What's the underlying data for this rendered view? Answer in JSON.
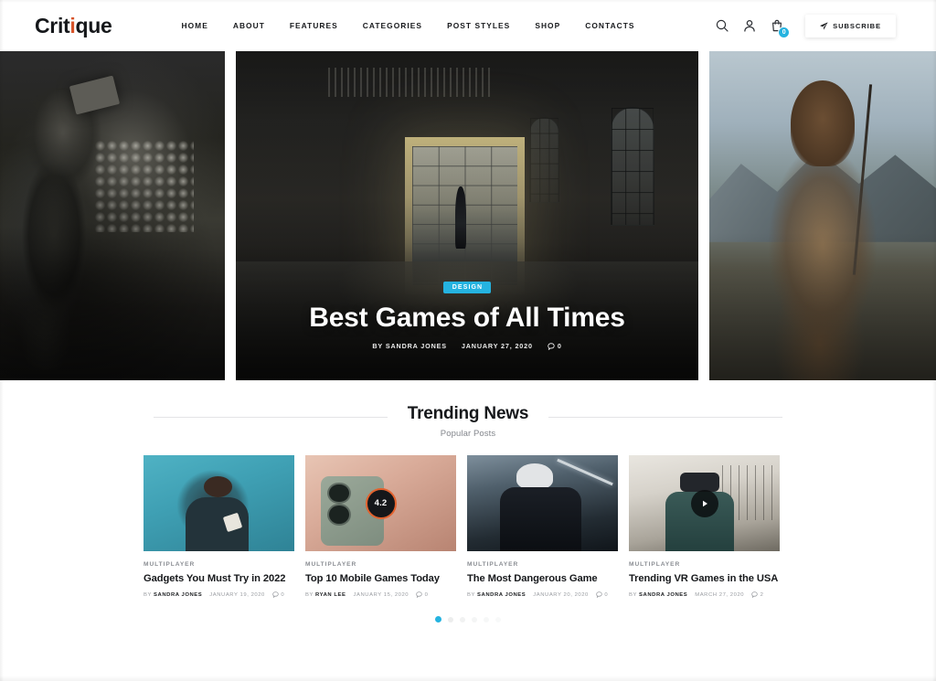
{
  "site": {
    "logo_text": "Critique",
    "logo_accent_letter": "i",
    "accent_color": "#d8542a",
    "brand_blue": "#25b3e0"
  },
  "nav": {
    "items": [
      {
        "label": "HOME"
      },
      {
        "label": "ABOUT"
      },
      {
        "label": "FEATURES"
      },
      {
        "label": "CATEGORIES"
      },
      {
        "label": "POST STYLES"
      },
      {
        "label": "SHOP"
      },
      {
        "label": "CONTACTS"
      }
    ]
  },
  "header_actions": {
    "search_icon": "search-icon",
    "account_icon": "user-icon",
    "cart_icon": "shopping-bag-icon",
    "cart_count": "0",
    "subscribe_label": "SUBSCRIBE",
    "subscribe_icon": "paper-plane-icon"
  },
  "hero": {
    "slides_count": 3,
    "featured": {
      "category": "DESIGN",
      "title": "Best Games of All Times",
      "author_prefix": "BY",
      "author": "SANDRA JONES",
      "date": "JANUARY 27, 2020",
      "comments": "0"
    }
  },
  "trending": {
    "title": "Trending News",
    "subtitle": "Popular Posts",
    "cards": [
      {
        "category": "MULTIPLAYER",
        "title": "Gadgets You Must Try in 2022",
        "author_prefix": "BY",
        "author": "SANDRA JONES",
        "date": "JANUARY 19, 2020",
        "comments": "0",
        "overlay": "none"
      },
      {
        "category": "MULTIPLAYER",
        "title": "Top 10 Mobile Games Today",
        "author_prefix": "BY",
        "author": "RYAN LEE",
        "date": "JANUARY 15, 2020",
        "comments": "0",
        "overlay": "rating",
        "rating": "4.2"
      },
      {
        "category": "MULTIPLAYER",
        "title": "The Most Dangerous Game",
        "author_prefix": "BY",
        "author": "SANDRA JONES",
        "date": "JANUARY 20, 2020",
        "comments": "0",
        "overlay": "none"
      },
      {
        "category": "MULTIPLAYER",
        "title": "Trending VR Games in the USA",
        "author_prefix": "BY",
        "author": "SANDRA JONES",
        "date": "MARCH 27, 2020",
        "comments": "2",
        "overlay": "play"
      }
    ],
    "pagination": {
      "active_index": 0,
      "total": 6
    }
  }
}
